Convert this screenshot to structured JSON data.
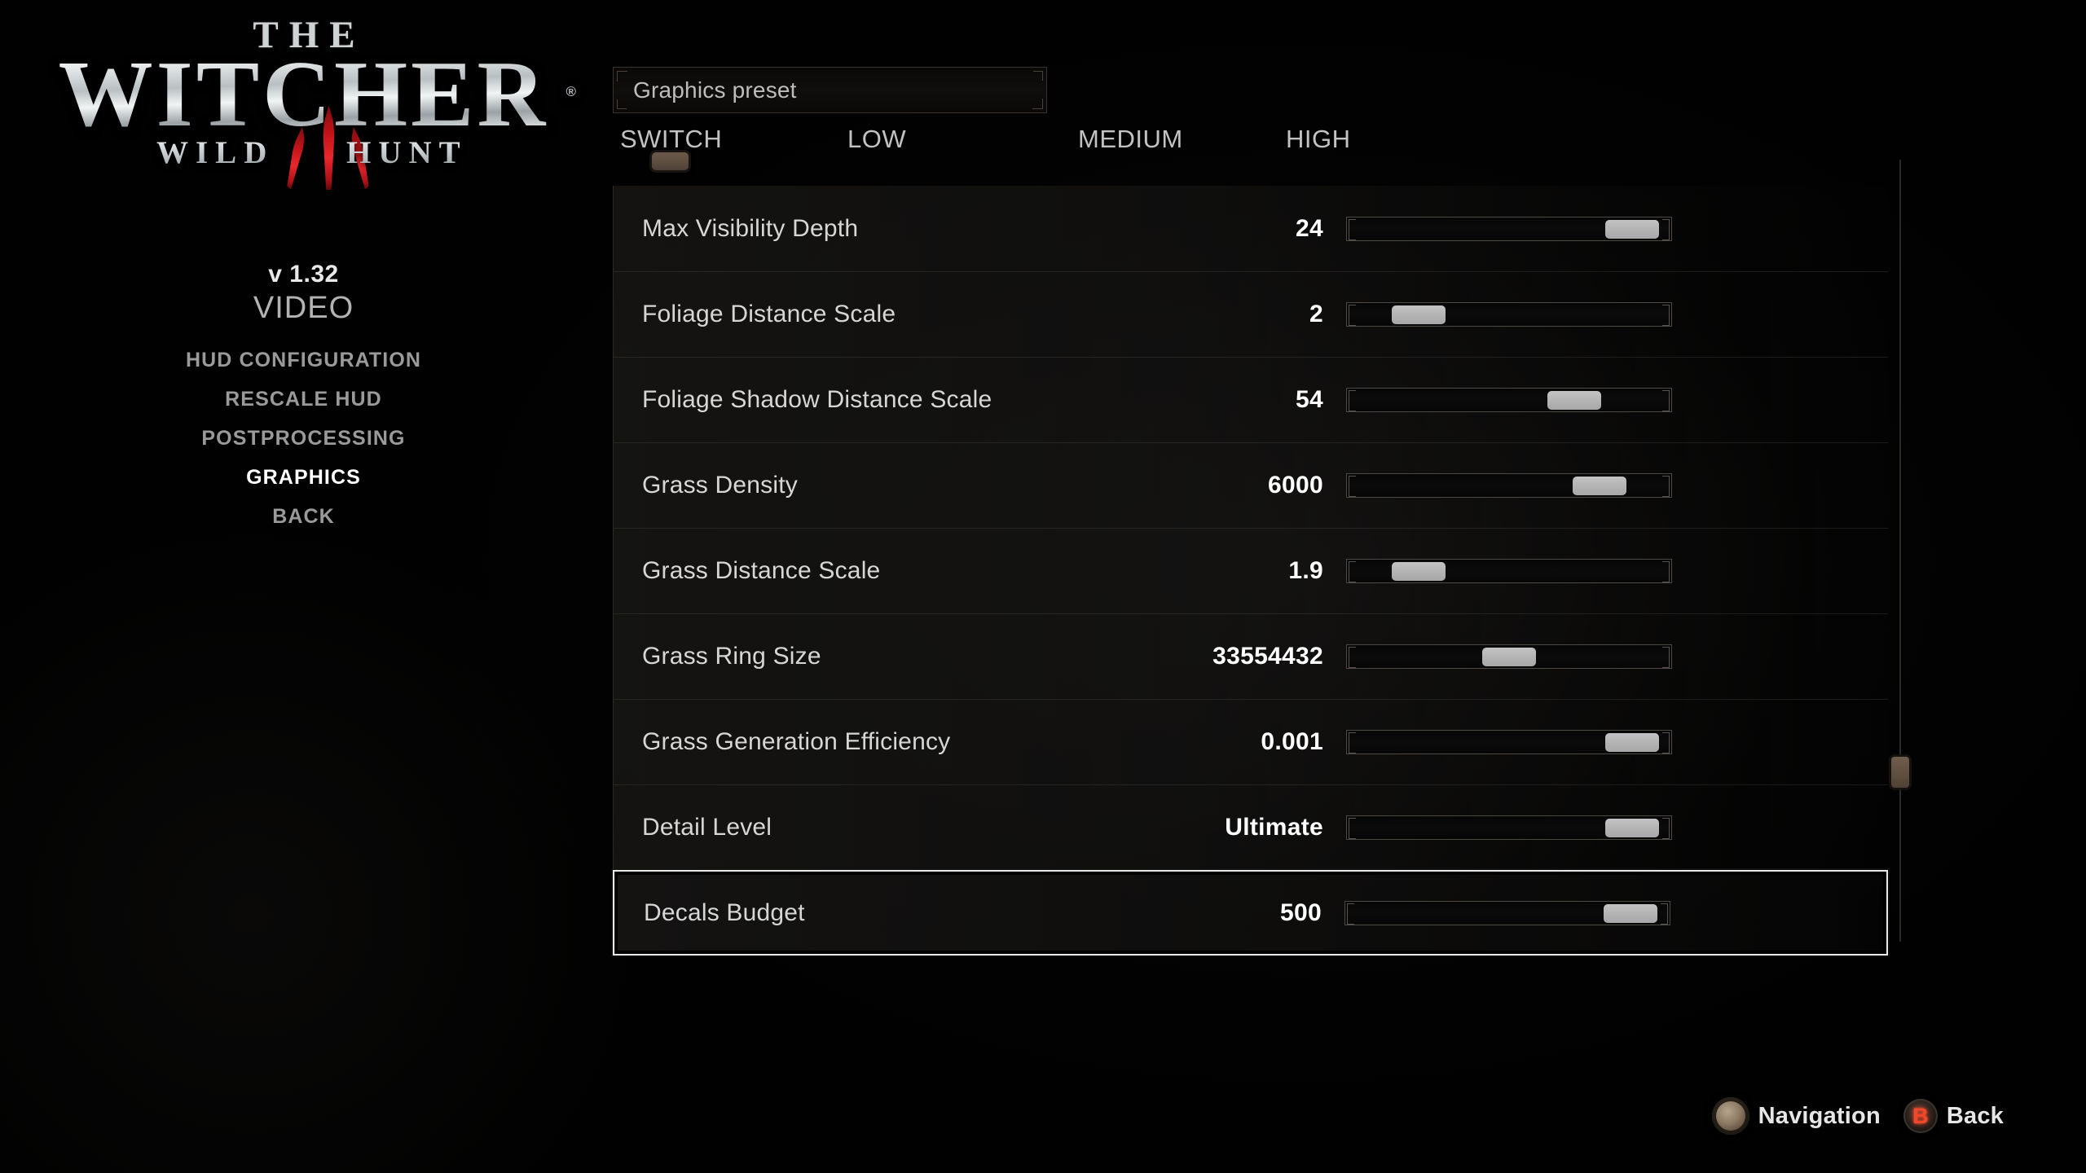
{
  "branding": {
    "the": "THE",
    "witcher": "WITCHER",
    "registered": "®",
    "wild": "WILD",
    "hunt": "HUNT",
    "claw_icon": "claw-mark-three-icon",
    "claw_color": "#c31419"
  },
  "sidebar": {
    "version": "v 1.32",
    "section_title": "VIDEO",
    "items": [
      {
        "label": "HUD CONFIGURATION",
        "active": false
      },
      {
        "label": "RESCALE HUD",
        "active": false
      },
      {
        "label": "POSTPROCESSING",
        "active": false
      },
      {
        "label": "GRAPHICS",
        "active": true
      },
      {
        "label": "BACK",
        "active": false
      }
    ]
  },
  "preset": {
    "box_label": "Graphics preset",
    "tabs": [
      "SWITCH",
      "LOW",
      "MEDIUM",
      "HIGH"
    ],
    "selected_tab": "SWITCH",
    "indicator_color": "#5d4e41"
  },
  "settings": [
    {
      "label": "Max Visibility Depth",
      "value": "24",
      "slider_pct": 88,
      "highlighted": false
    },
    {
      "label": "Foliage Distance Scale",
      "value": "2",
      "slider_pct": 22,
      "highlighted": false
    },
    {
      "label": "Foliage Shadow Distance Scale",
      "value": "54",
      "slider_pct": 70,
      "highlighted": false
    },
    {
      "label": "Grass Density",
      "value": "6000",
      "slider_pct": 78,
      "highlighted": false
    },
    {
      "label": "Grass Distance Scale",
      "value": "1.9",
      "slider_pct": 22,
      "highlighted": false
    },
    {
      "label": "Grass Ring Size",
      "value": "33554432",
      "slider_pct": 50,
      "highlighted": false
    },
    {
      "label": "Grass Generation Efficiency",
      "value": "0.001",
      "slider_pct": 88,
      "highlighted": false
    },
    {
      "label": "Detail Level",
      "value": "Ultimate",
      "slider_pct": 88,
      "highlighted": false
    },
    {
      "label": "Decals Budget",
      "value": "500",
      "slider_pct": 88,
      "highlighted": true
    }
  ],
  "scrollbar": {
    "thumb_pct": 76
  },
  "footer": {
    "hints": [
      {
        "icon": "analog-stick-icon",
        "label": "Navigation"
      },
      {
        "icon": "button-b-icon",
        "glyph": "B",
        "label": "Back",
        "color": "#f2472a"
      }
    ]
  }
}
